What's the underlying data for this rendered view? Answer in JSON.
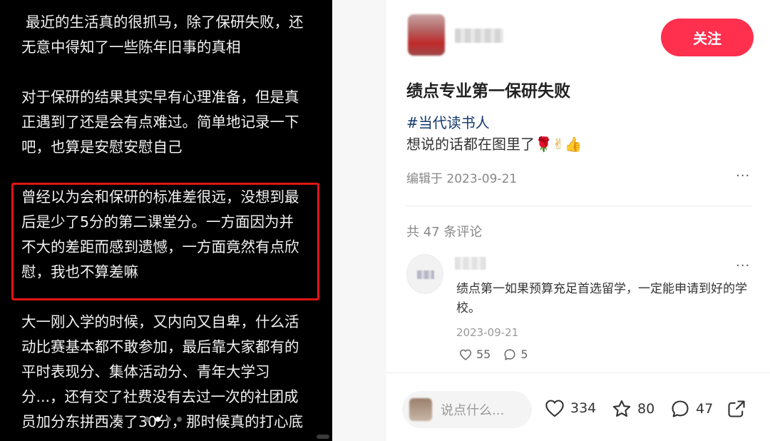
{
  "image": {
    "paragraphs": [
      [
        "最近的生活真的很抓马，除了保研失败，还",
        "无意中得知了一些陈年旧事的真相"
      ],
      [
        "对于保研的结果其实早有心理准备，但是真",
        "正遇到了还是会有点难过。简单地记录一下",
        "吧，也算是安慰安慰自己"
      ],
      [
        "曾经以为会和保研的标准差很远，没想到最",
        "后是少了5分的第二课堂分。一方面因为并",
        "不大的差距而感到遗憾，一方面竟然有点欣",
        "慰，我也不算差嘛"
      ],
      [
        "大一刚入学的时候，又内向又自卑，什么活",
        "动比赛基本都不敢参加，最后靠大家都有的",
        "平时表现分、集体活动分、青年大学习",
        "分...，还有交了社费没有去过一次的社团成",
        "员加分东拼西凑了30分，那时候真的打心底"
      ]
    ]
  },
  "note": {
    "follow_label": "关注",
    "title": "绩点专业第一保研失败",
    "hashtag": "#当代读书人",
    "content": "想说的话都在图里了",
    "content_emoji": "🌹✌👍",
    "edit_date": "编辑于 2023-09-21",
    "more": "···",
    "comment_count": "共 47 条评论"
  },
  "comment": {
    "text": "绩点第一如果预算充足首选留学，一定能申请到好的学校。",
    "date": "2023-09-21",
    "likes": "55",
    "replies": "5",
    "more": "···"
  },
  "bottom": {
    "placeholder": "说点什么...",
    "likes": "334",
    "collects": "80",
    "comments": "47"
  }
}
